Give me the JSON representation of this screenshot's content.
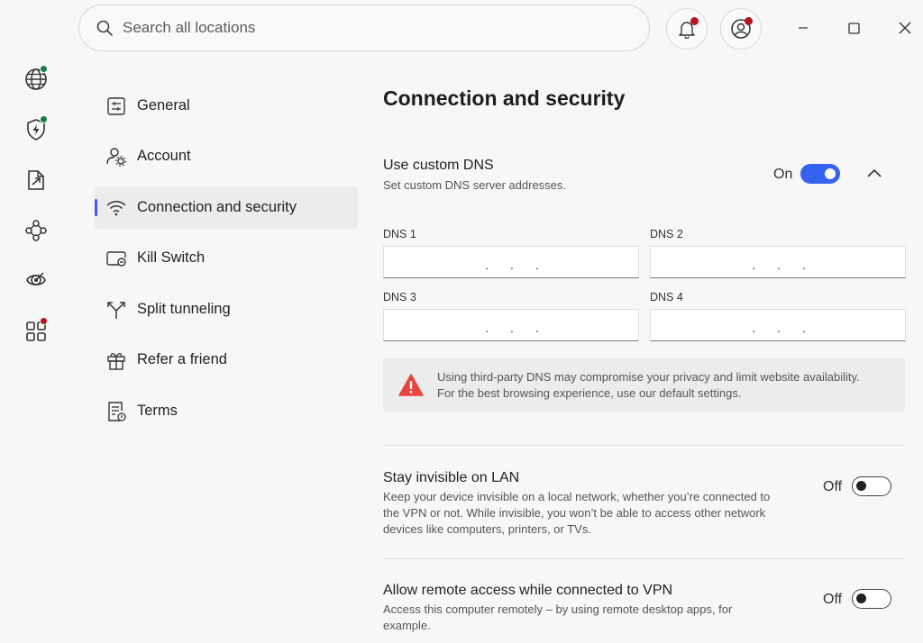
{
  "search": {
    "placeholder": "Search all locations"
  },
  "rail": [
    {
      "name": "globe",
      "dot": "#1a8040"
    },
    {
      "name": "shield-bolt",
      "dot": "#1a8040"
    },
    {
      "name": "share-file",
      "dot": null
    },
    {
      "name": "mesh-network",
      "dot": null
    },
    {
      "name": "target",
      "dot": null
    },
    {
      "name": "apps",
      "dot": "#b3141d"
    }
  ],
  "nav": [
    {
      "label": "General",
      "icon": "sliders-icon"
    },
    {
      "label": "Account",
      "icon": "account-gear-icon"
    },
    {
      "label": "Connection and security",
      "icon": "wifi-icon",
      "active": true
    },
    {
      "label": "Kill Switch",
      "icon": "kill-switch-icon"
    },
    {
      "label": "Split tunneling",
      "icon": "split-arrows-icon"
    },
    {
      "label": "Refer a friend",
      "icon": "gift-icon"
    },
    {
      "label": "Terms",
      "icon": "document-icon"
    }
  ],
  "content": {
    "title": "Connection and security",
    "custom_dns": {
      "title": "Use custom DNS",
      "description": "Set custom DNS server addresses.",
      "state_label": "On",
      "enabled": true
    },
    "dns": [
      {
        "label": "DNS 1",
        "value": ". . ."
      },
      {
        "label": "DNS 2",
        "value": ". . ."
      },
      {
        "label": "DNS 3",
        "value": ". . ."
      },
      {
        "label": "DNS 4",
        "value": ". . ."
      }
    ],
    "warning": "Using third-party DNS may compromise your privacy and limit website availability. For the best browsing experience, use our default settings.",
    "invisible_lan": {
      "title": "Stay invisible on LAN",
      "description": "Keep your device invisible on a local network, whether you’re connected to the VPN or not. While invisible, you won’t be able to access other network devices like computers, printers, or TVs.",
      "state_label": "Off",
      "enabled": false
    },
    "remote_access": {
      "title": "Allow remote access while connected to VPN",
      "description": "Access this computer remotely – by using remote desktop apps, for example.",
      "state_label": "Off",
      "enabled": false
    }
  },
  "colors": {
    "accent": "#3463f0",
    "active_bar": "#3d5afe",
    "warning": "#e8453c",
    "notification_dot": "#b3141d",
    "online_dot": "#1a8040"
  }
}
